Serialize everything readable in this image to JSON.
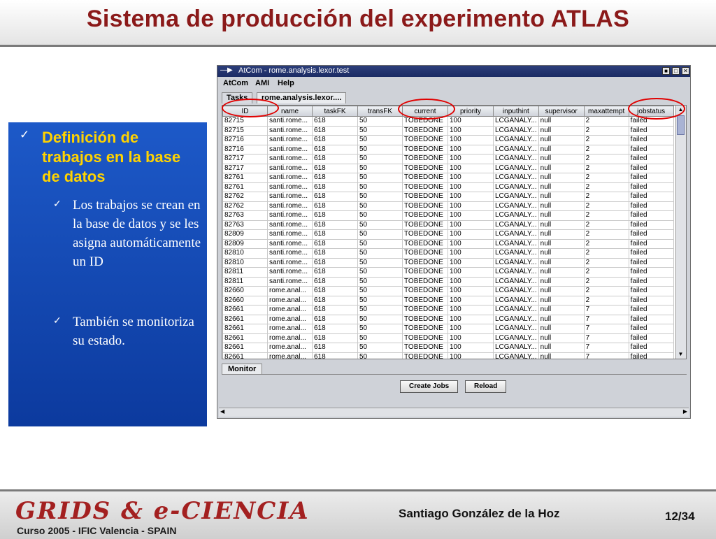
{
  "slide": {
    "title": "Sistema de producción del experimento ATLAS",
    "bullet": "Definición de trabajos en la base de datos",
    "subbullets": [
      "Los trabajos se crean en la base de datos y se les asigna automáticamente un ID",
      "También se monitoriza su estado."
    ],
    "check_icon": "✓"
  },
  "window": {
    "title": "AtCom - rome.analysis.lexor.test",
    "menu": [
      "AtCom",
      "AMI",
      "Help"
    ],
    "tabs": [
      "Tasks",
      "rome.analysis.lexor...."
    ],
    "table": {
      "columns": [
        "ID",
        "name",
        "taskFK",
        "transFK",
        "current",
        "priority",
        "inputhint",
        "supervisor",
        "maxattempt",
        "jobstatus"
      ],
      "rows": [
        [
          "82715",
          "santi.rome...",
          "618",
          "50",
          "TOBEDONE",
          "100",
          "LCGANALY...",
          "null",
          "2",
          "failed"
        ],
        [
          "82715",
          "santi.rome...",
          "618",
          "50",
          "TOBEDONE",
          "100",
          "LCGANALY...",
          "null",
          "2",
          "failed"
        ],
        [
          "82716",
          "santi.rome...",
          "618",
          "50",
          "TOBEDONE",
          "100",
          "LCGANALY...",
          "null",
          "2",
          "failed"
        ],
        [
          "82716",
          "santi.rome...",
          "618",
          "50",
          "TOBEDONE",
          "100",
          "LCGANALY...",
          "null",
          "2",
          "failed"
        ],
        [
          "82717",
          "santi.rome...",
          "618",
          "50",
          "TOBEDONE",
          "100",
          "LCGANALY...",
          "null",
          "2",
          "failed"
        ],
        [
          "82717",
          "santi.rome...",
          "618",
          "50",
          "TOBEDONE",
          "100",
          "LCGANALY...",
          "null",
          "2",
          "failed"
        ],
        [
          "82761",
          "santi.rome...",
          "618",
          "50",
          "TOBEDONE",
          "100",
          "LCGANALY...",
          "null",
          "2",
          "failed"
        ],
        [
          "82761",
          "santi.rome...",
          "618",
          "50",
          "TOBEDONE",
          "100",
          "LCGANALY...",
          "null",
          "2",
          "failed"
        ],
        [
          "82762",
          "santi.rome...",
          "618",
          "50",
          "TOBEDONE",
          "100",
          "LCGANALY...",
          "null",
          "2",
          "failed"
        ],
        [
          "82762",
          "santi.rome...",
          "618",
          "50",
          "TOBEDONE",
          "100",
          "LCGANALY...",
          "null",
          "2",
          "failed"
        ],
        [
          "82763",
          "santi.rome...",
          "618",
          "50",
          "TOBEDONE",
          "100",
          "LCGANALY...",
          "null",
          "2",
          "failed"
        ],
        [
          "82763",
          "santi.rome...",
          "618",
          "50",
          "TOBEDONE",
          "100",
          "LCGANALY...",
          "null",
          "2",
          "failed"
        ],
        [
          "82809",
          "santi.rome...",
          "618",
          "50",
          "TOBEDONE",
          "100",
          "LCGANALY...",
          "null",
          "2",
          "failed"
        ],
        [
          "82809",
          "santi.rome...",
          "618",
          "50",
          "TOBEDONE",
          "100",
          "LCGANALY...",
          "null",
          "2",
          "failed"
        ],
        [
          "82810",
          "santi.rome...",
          "618",
          "50",
          "TOBEDONE",
          "100",
          "LCGANALY...",
          "null",
          "2",
          "failed"
        ],
        [
          "82810",
          "santi.rome...",
          "618",
          "50",
          "TOBEDONE",
          "100",
          "LCGANALY...",
          "null",
          "2",
          "failed"
        ],
        [
          "82811",
          "santi.rome...",
          "618",
          "50",
          "TOBEDONE",
          "100",
          "LCGANALY...",
          "null",
          "2",
          "failed"
        ],
        [
          "82811",
          "santi.rome...",
          "618",
          "50",
          "TOBEDONE",
          "100",
          "LCGANALY...",
          "null",
          "2",
          "failed"
        ],
        [
          "82660",
          "rome.anal...",
          "618",
          "50",
          "TOBEDONE",
          "100",
          "LCGANALY...",
          "null",
          "2",
          "failed"
        ],
        [
          "82660",
          "rome.anal...",
          "618",
          "50",
          "TOBEDONE",
          "100",
          "LCGANALY...",
          "null",
          "2",
          "failed"
        ],
        [
          "82661",
          "rome.anal...",
          "618",
          "50",
          "TOBEDONE",
          "100",
          "LCGANALY...",
          "null",
          "7",
          "failed"
        ],
        [
          "82661",
          "rome.anal...",
          "618",
          "50",
          "TOBEDONE",
          "100",
          "LCGANALY...",
          "null",
          "7",
          "failed"
        ],
        [
          "82661",
          "rome.anal...",
          "618",
          "50",
          "TOBEDONE",
          "100",
          "LCGANALY...",
          "null",
          "7",
          "failed"
        ],
        [
          "82661",
          "rome.anal...",
          "618",
          "50",
          "TOBEDONE",
          "100",
          "LCGANALY...",
          "null",
          "7",
          "failed"
        ],
        [
          "82661",
          "rome.anal...",
          "618",
          "50",
          "TOBEDONE",
          "100",
          "LCGANALY...",
          "null",
          "7",
          "failed"
        ],
        [
          "82661",
          "rome.anal...",
          "618",
          "50",
          "TOBEDONE",
          "100",
          "LCGANALY...",
          "null",
          "7",
          "failed"
        ]
      ]
    },
    "bottom_tab": "Monitor",
    "buttons": [
      "Create Jobs",
      "Reload"
    ]
  },
  "footer": {
    "logo": "GRIDS & e-CIENCIA",
    "logo_sub": "Curso 2005 - IFIC Valencia - SPAIN",
    "author": "Santiago González de la Hoz",
    "page": "12/34"
  },
  "highlight_color": "#e00000"
}
